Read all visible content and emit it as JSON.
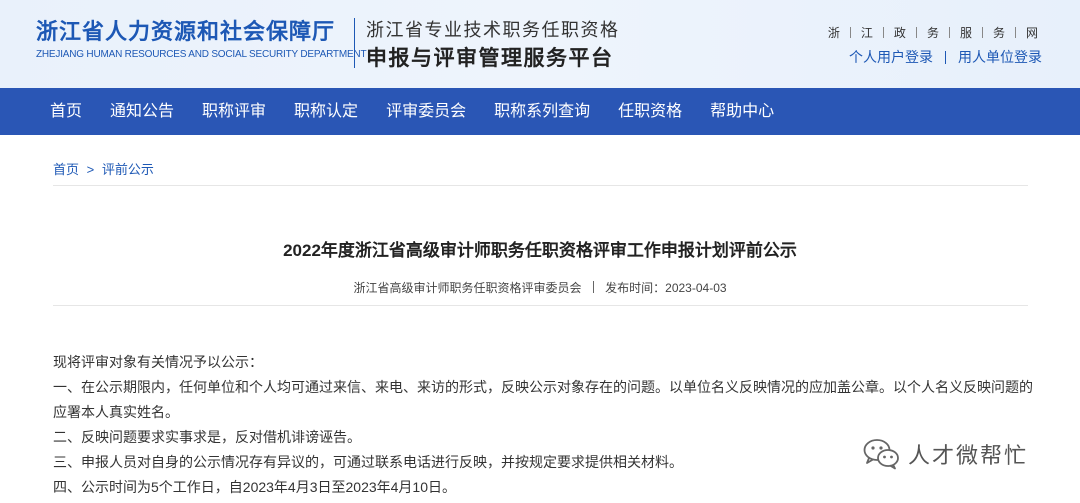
{
  "header": {
    "org_name": "浙江省人力资源和社会保障厅",
    "org_name_en": "ZHEJIANG HUMAN RESOURCES AND SOCIAL SECURITY DEPARTMENT",
    "system_line1": "浙江省专业技术职务任职资格",
    "system_line2": "申报与评审管理服务平台",
    "portal_chars": [
      "浙",
      "江",
      "政",
      "务",
      "服",
      "务",
      "网"
    ],
    "personal_login": "个人用户登录",
    "unit_login": "用人单位登录"
  },
  "nav": {
    "items": [
      "首页",
      "通知公告",
      "职称评审",
      "职称认定",
      "评审委员会",
      "职称系列查询",
      "任职资格",
      "帮助中心"
    ]
  },
  "breadcrumb": {
    "home": "首页",
    "separator": ">",
    "current": "评前公示"
  },
  "article": {
    "title": "2022年度浙江省高级审计师职务任职资格评审工作申报计划评前公示",
    "source": "浙江省高级审计师职务任职资格评审委员会",
    "publish_label": "发布时间：2023-04-03",
    "paragraphs": [
      "现将评审对象有关情况予以公示：",
      "一、在公示期限内，任何单位和个人均可通过来信、来电、来访的形式，反映公示对象存在的问题。以单位名义反映情况的应加盖公章。以个人名义反映问题的应署本人真实姓名。",
      "二、反映问题要求实事求是，反对借机诽谤诬告。",
      "三、申报人员对自身的公示情况存有异议的，可通过联系电话进行反映，并按规定要求提供相关材料。",
      "四、公示时间为5个工作日，自2023年4月3日至2023年4月10日。"
    ]
  },
  "watermark": {
    "text": "人才微帮忙",
    "icon": "wechat-icon"
  },
  "colors": {
    "brand_blue": "#1d58b5",
    "nav_bg": "#2a56b5",
    "header_bg": "#eaf2fb"
  }
}
